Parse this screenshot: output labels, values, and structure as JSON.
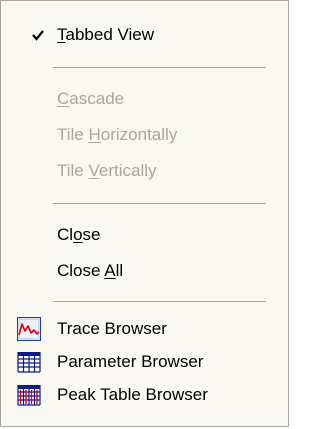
{
  "menu": {
    "items": [
      {
        "label_pre": "",
        "label_ul": "T",
        "label_post": "abbed View",
        "checked": true,
        "enabled": true
      },
      {
        "label_pre": "",
        "label_ul": "C",
        "label_post": "ascade",
        "enabled": false
      },
      {
        "label_pre": "Tile ",
        "label_ul": "H",
        "label_post": "orizontally",
        "enabled": false
      },
      {
        "label_pre": "Tile ",
        "label_ul": "V",
        "label_post": "ertically",
        "enabled": false
      },
      {
        "label_pre": "Cl",
        "label_ul": "o",
        "label_post": "se",
        "enabled": true
      },
      {
        "label_pre": "Close ",
        "label_ul": "A",
        "label_post": "ll",
        "enabled": true
      },
      {
        "label": "Trace Browser",
        "icon": "trace-browser-icon",
        "enabled": true
      },
      {
        "label": "Parameter Browser",
        "icon": "parameter-browser-icon",
        "enabled": true
      },
      {
        "label": "Peak Table Browser",
        "icon": "peak-table-browser-icon",
        "enabled": true
      }
    ]
  },
  "colors": {
    "background": "#f9f8f3",
    "disabled_text": "#a9a79c",
    "separator": "#a7a69c"
  }
}
